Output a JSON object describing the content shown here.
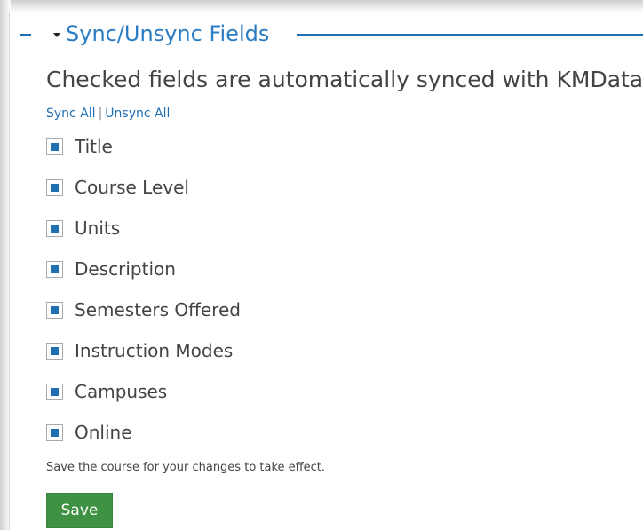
{
  "section": {
    "title": "Sync/Unsync Fields",
    "heading": "Checked fields are automatically synced with KMData",
    "sync_all": "Sync All",
    "separator": "|",
    "unsync_all": "Unsync All"
  },
  "fields": [
    {
      "label": "Title",
      "checked": true
    },
    {
      "label": "Course Level",
      "checked": true
    },
    {
      "label": "Units",
      "checked": true
    },
    {
      "label": "Description",
      "checked": true
    },
    {
      "label": "Semesters Offered",
      "checked": true
    },
    {
      "label": "Instruction Modes",
      "checked": true
    },
    {
      "label": "Campuses",
      "checked": true
    },
    {
      "label": "Online",
      "checked": true
    }
  ],
  "note": "Save the course for your changes to take effect.",
  "save_label": "Save",
  "colors": {
    "accent": "#1f6fb2",
    "save_button": "#3f9144"
  }
}
